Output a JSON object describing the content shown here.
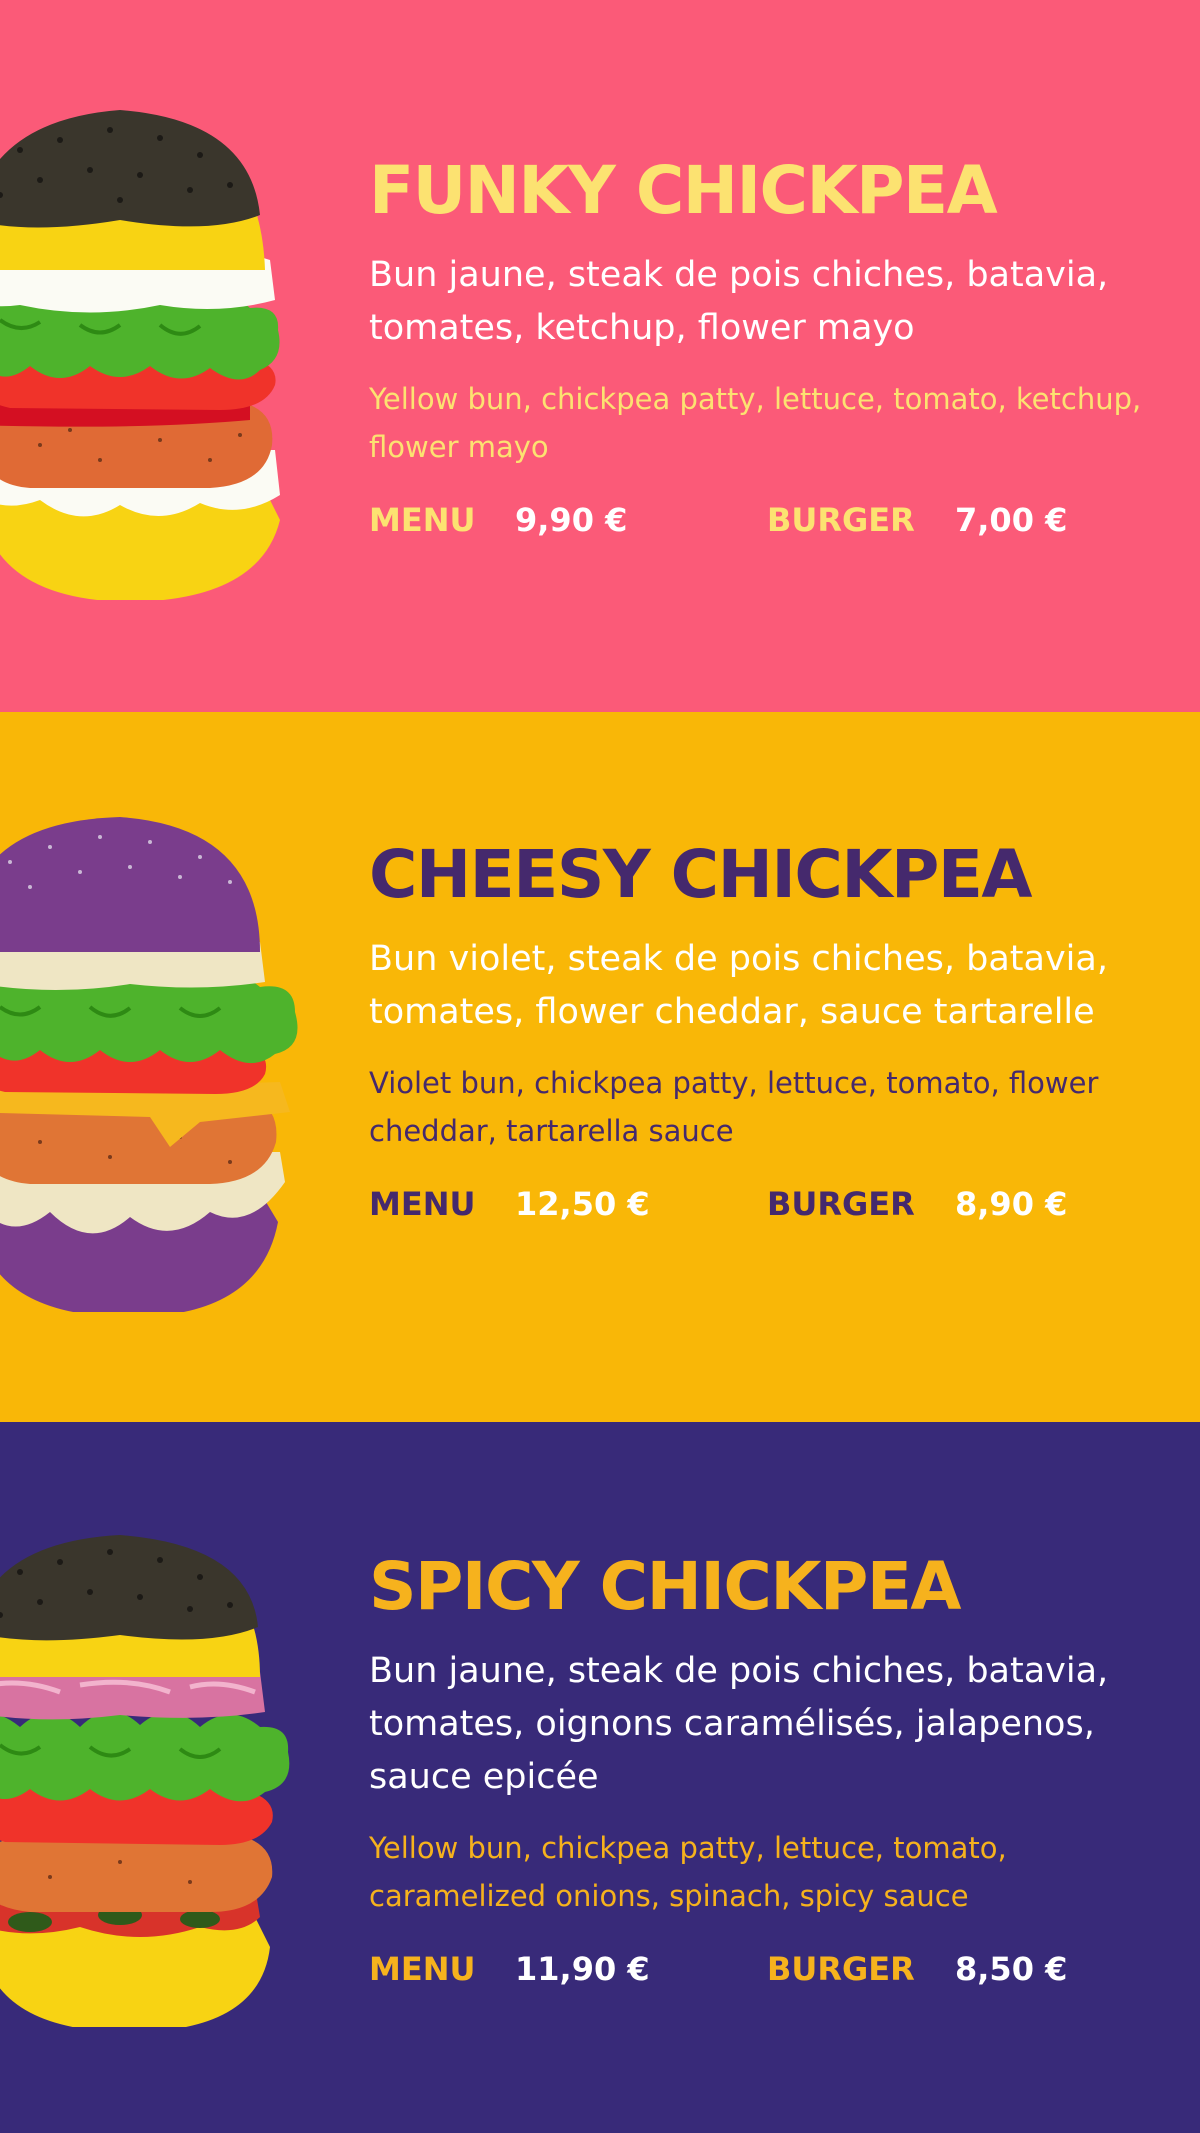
{
  "burgers": [
    {
      "name": "FUNKY CHICKPEA",
      "description_fr": "Bun jaune, steak de pois chiches, batavia, tomates, ketchup, flower mayo",
      "description_en": "Yellow bun, chickpea patty, lettuce, tomato, ketchup, flower mayo",
      "menu_label": "MENU",
      "menu_price": "9,90 €",
      "burger_label": "BURGER",
      "burger_price": "7,00 €",
      "background_color": "#fb5a78",
      "accent_color": "#fce271",
      "bun_color": "#f8d313"
    },
    {
      "name": "CHEESY CHICKPEA",
      "description_fr": "Bun violet, steak de pois chiches, batavia, tomates, flower cheddar, sauce tartarelle",
      "description_en": "Violet bun, chickpea patty, lettuce, tomato, flower cheddar, tartarella sauce",
      "menu_label": "MENU",
      "menu_price": "12,50 €",
      "burger_label": "BURGER",
      "burger_price": "8,90 €",
      "background_color": "#f9b707",
      "accent_color": "#45296d",
      "bun_color": "#7a3d8c"
    },
    {
      "name": "SPICY CHICKPEA",
      "description_fr": "Bun jaune, steak de pois chiches, batavia, tomates, oignons caramélisés, jalapenos, sauce epicée",
      "description_en": "Yellow bun, chickpea patty, lettuce, tomato, caramelized onions, spinach, spicy sauce",
      "menu_label": "MENU",
      "menu_price": "11,90 €",
      "burger_label": "BURGER",
      "burger_price": "8,50 €",
      "background_color": "#382a79",
      "accent_color": "#f6b21d",
      "bun_color": "#f8d313"
    }
  ]
}
